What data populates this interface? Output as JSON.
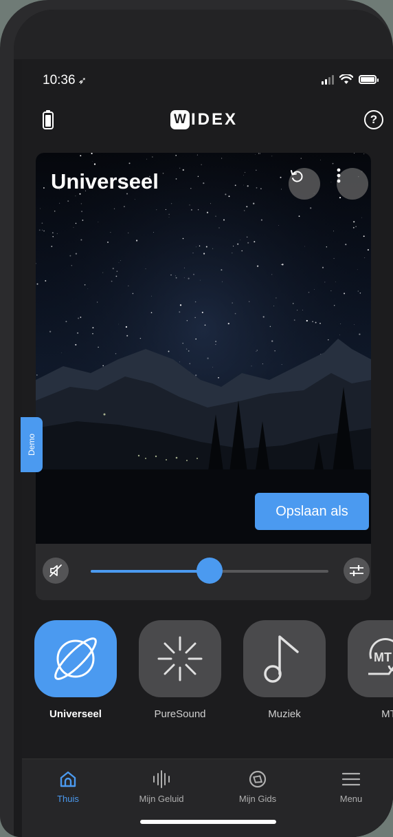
{
  "status_bar": {
    "time": "10:36",
    "location_arrow": "location-arrow-icon"
  },
  "header": {
    "logo_badge": "W",
    "logo_text": "IDEX",
    "help_label": "?"
  },
  "program": {
    "title": "Universeel",
    "save_label": "Opslaan als",
    "volume_level_percent": 50
  },
  "demo_label": "Demo",
  "tiles": [
    {
      "label": "Universeel",
      "icon": "planet-icon",
      "active": true
    },
    {
      "label": "PureSound",
      "icon": "starburst-icon",
      "active": false
    },
    {
      "label": "Muziek",
      "icon": "music-note-icon",
      "active": false
    },
    {
      "label": "MT",
      "icon": "mt-icon",
      "active": false
    }
  ],
  "tabs": [
    {
      "label": "Thuis",
      "icon": "home-icon",
      "active": true
    },
    {
      "label": "Mijn Geluid",
      "icon": "soundwave-icon",
      "active": false
    },
    {
      "label": "Mijn Gids",
      "icon": "compass-icon",
      "active": false
    },
    {
      "label": "Menu",
      "icon": "hamburger-menu-icon",
      "active": false
    }
  ],
  "colors": {
    "accent": "#4b9af0",
    "background": "#1c1c1e",
    "tile": "#4a4a4c"
  }
}
